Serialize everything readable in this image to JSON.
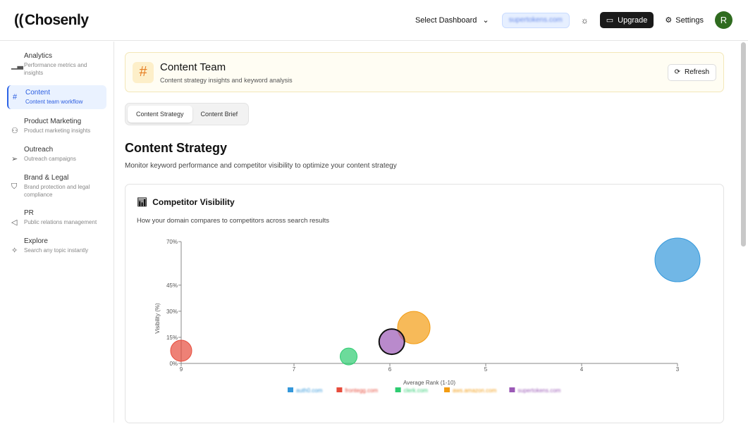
{
  "header": {
    "logo": "Chosenly",
    "dashboard_select": "Select Dashboard",
    "domain": "supertokens.com",
    "upgrade": "Upgrade",
    "settings": "Settings",
    "avatar": "R"
  },
  "sidebar": {
    "items": [
      {
        "label": "Analytics",
        "desc": "Performance metrics and insights",
        "icon": "bar-chart-icon"
      },
      {
        "label": "Content",
        "desc": "Content team workflow",
        "icon": "hash-icon",
        "active": true
      },
      {
        "label": "Product Marketing",
        "desc": "Product marketing insights",
        "icon": "users-icon"
      },
      {
        "label": "Outreach",
        "desc": "Outreach campaigns",
        "icon": "send-icon"
      },
      {
        "label": "Brand & Legal",
        "desc": "Brand protection and legal compliance",
        "icon": "shield-icon"
      },
      {
        "label": "PR",
        "desc": "Public relations management",
        "icon": "megaphone-icon"
      },
      {
        "label": "Explore",
        "desc": "Search any topic instantly",
        "icon": "sparkles-icon"
      }
    ]
  },
  "banner": {
    "title": "Content Team",
    "subtitle": "Content strategy insights and keyword analysis",
    "refresh": "Refresh"
  },
  "tabs": [
    "Content Strategy",
    "Content Brief"
  ],
  "page": {
    "title": "Content Strategy",
    "subtitle": "Monitor keyword performance and competitor visibility to optimize your content strategy"
  },
  "card": {
    "title": "Competitor Visibility",
    "subtitle": "How your domain compares to competitors across search results"
  },
  "chart_data": {
    "type": "scatter",
    "xlabel": "Average Rank (1-10)",
    "ylabel": "Visibility (%)",
    "xticks": [
      9,
      7,
      6,
      5,
      4,
      3
    ],
    "yticks": [
      0,
      15,
      30,
      45,
      70
    ],
    "x_reversed": true,
    "legend": "bottom",
    "series": [
      {
        "name": "auth0.com",
        "x": 3,
        "y": 59.5,
        "color": "#3498db"
      },
      {
        "name": "frontegg.com",
        "x": 9,
        "y": 7.3,
        "color": "#e74c3c"
      },
      {
        "name": "clerk.com",
        "x": 6.43,
        "y": 4,
        "color": "#2ecc71"
      },
      {
        "name": "aws.amazon.com",
        "x": 5.75,
        "y": 20.6,
        "color": "#f39c12"
      },
      {
        "name": "supertokens.com",
        "x": 5.98,
        "y": 12.5,
        "color": "#9b59b6",
        "highlighted": true
      }
    ]
  }
}
